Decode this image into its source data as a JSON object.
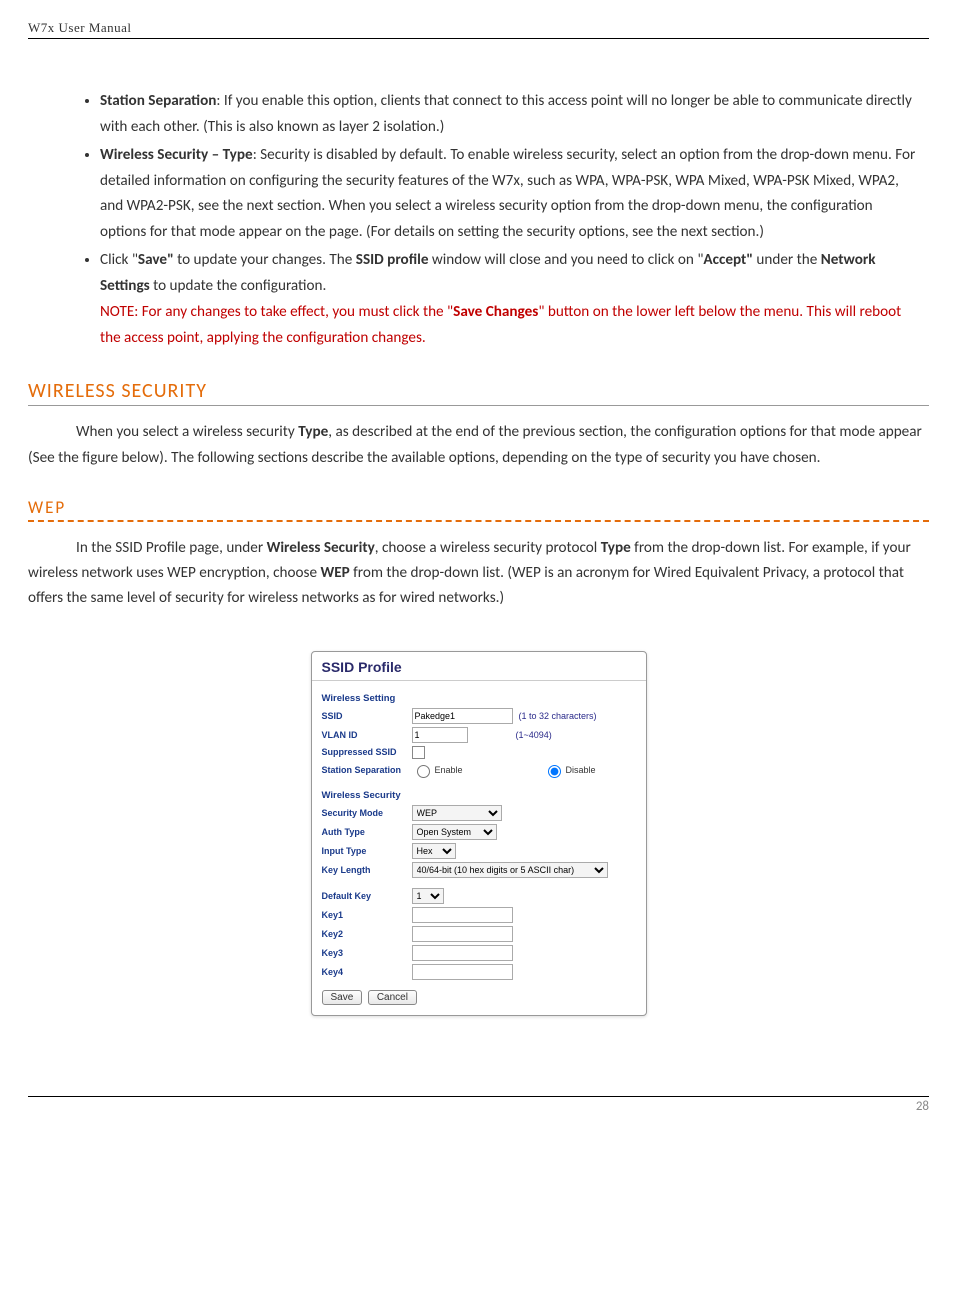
{
  "header": {
    "title": "W7x  User Manual"
  },
  "bullets": {
    "b1_prefix": "Station Separation",
    "b1_rest": ": If you enable this option, clients that connect to this access point will no longer be able to communicate directly with each other. (This is also known as layer 2 isolation.)",
    "b2_prefix": "Wireless Security – Type",
    "b2_rest": ": Security is disabled by default. To enable wireless security, select an option from the drop-down menu. For detailed information on configuring the security features of the W7x, such as WPA, WPA-PSK, WPA Mixed, WPA-PSK Mixed, WPA2, and WPA2-PSK, see the next section. When you select a wireless security option from the drop-down menu, the configuration options for that mode appear on the page. (For details on setting the security options, see the next section.)",
    "b3_p1": "Click \"",
    "b3_save": "Save\"",
    "b3_p2": " to update your changes. The ",
    "b3_ssid": "SSID profile",
    "b3_p3": " window will close and you need to click on \"",
    "b3_accept": "Accept\"",
    "b3_p4": " under the ",
    "b3_ns": "Network Settings",
    "b3_p5": " to update the configuration.",
    "note_p1": "NOTE: For any changes to take effect, you must click the \"",
    "note_sc": "Save Changes",
    "note_p2": "\" button on the lower left below the menu.  This will reboot the access point, applying the configuration changes."
  },
  "section1": {
    "title": "WIRELESS SECURITY",
    "para_p1": "When you select a wireless security ",
    "para_type": "Type",
    "para_p2": ", as described at the end of the previous section, the configuration options for that mode appear (See the figure below). The following sections describe the available options, depending on the type of security you have chosen."
  },
  "section2": {
    "title": "WEP",
    "para_p1": "In the SSID Profile page, under ",
    "para_ws": "Wireless Security",
    "para_p2": ", choose a wireless security protocol ",
    "para_type": "Type",
    "para_p3": " from the drop-down list. For example, if your wireless network uses WEP encryption, choose ",
    "para_wep": "WEP",
    "para_p4": " from the drop-down list. (WEP is an acronym for Wired Equivalent Privacy, a protocol that offers the same level of security for wireless networks as for wired networks.)"
  },
  "ss": {
    "title": "SSID Profile",
    "group1": "Wireless Setting",
    "ssid_lbl": "SSID",
    "ssid_val": "Pakedge1",
    "ssid_hint": "(1 to 32 characters)",
    "vlan_lbl": "VLAN ID",
    "vlan_val": "1",
    "vlan_hint": "(1~4094)",
    "sup_lbl": "Suppressed SSID",
    "sep_lbl": "Station Separation",
    "enable": "Enable",
    "disable": "Disable",
    "group2": "Wireless Security",
    "sec_lbl": "Security Mode",
    "sec_val": "WEP",
    "auth_lbl": "Auth Type",
    "auth_val": "Open System",
    "inp_lbl": "Input Type",
    "inp_val": "Hex",
    "len_lbl": "Key Length",
    "len_val": "40/64-bit (10 hex digits or 5 ASCII char)",
    "def_lbl": "Default Key",
    "def_val": "1",
    "k1": "Key1",
    "k2": "Key2",
    "k3": "Key3",
    "k4": "Key4",
    "save": "Save",
    "cancel": "Cancel"
  },
  "footer": {
    "page": "28"
  }
}
